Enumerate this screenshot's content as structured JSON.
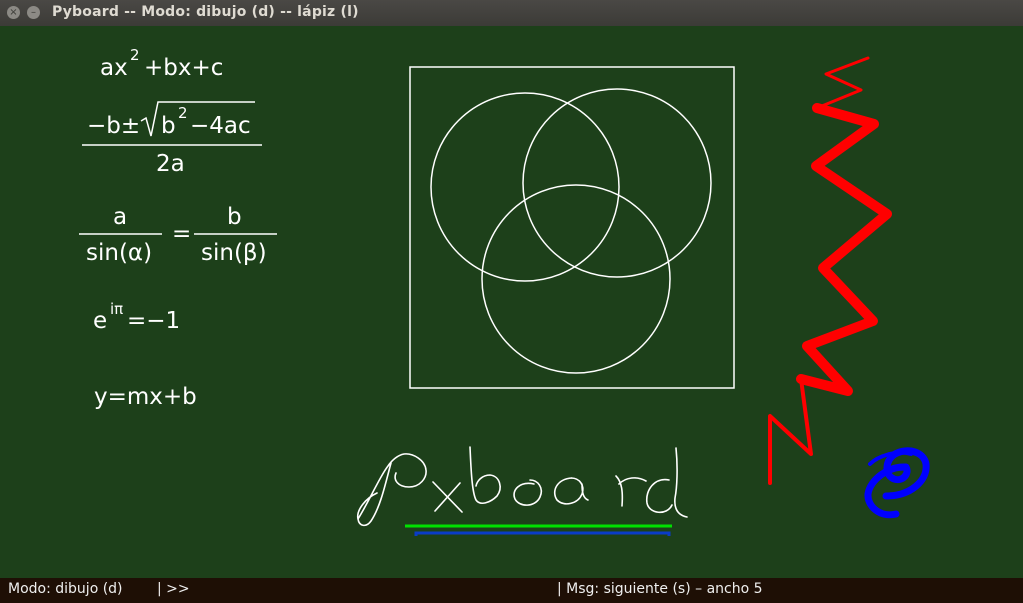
{
  "window": {
    "title": "Pyboard -- Modo: dibujo (d) -- lápiz (l)",
    "close_glyph": "×",
    "minimize_glyph": "–"
  },
  "formulas": {
    "quadratic": {
      "base": "ax",
      "exp": "2",
      "rest": "+bx+c"
    },
    "quadratic_formula": {
      "prefix": "−b±",
      "root_b": "b",
      "root_exp": "2",
      "root_rest": "−4ac",
      "denominator": "2a"
    },
    "law_of_sines": {
      "num_left": "a",
      "den_left": "sin(α)",
      "equals": "=",
      "num_right": "b",
      "den_right": "sin(β)"
    },
    "euler": {
      "base": "e",
      "exp": "iπ",
      "rest": "=−1"
    },
    "line": "y=mx+b"
  },
  "colors": {
    "board": "#1d401a",
    "chalk": "#ffffff",
    "red_stroke": "#ff0000",
    "blue_stroke": "#0000ff",
    "green_underline": "#00e000",
    "blue_underline": "#0a3cc8"
  },
  "status": {
    "mode": "Modo: dibujo (d)",
    "command": "| >>",
    "message": "| Msg: siguiente (s) – ancho 5"
  }
}
